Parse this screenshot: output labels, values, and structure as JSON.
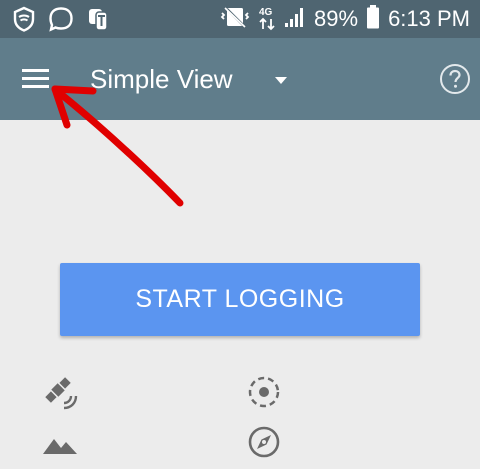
{
  "status_bar": {
    "battery_percent": "89%",
    "time": "6:13 PM",
    "left_icons": [
      "shield-icon",
      "chat-bubble-icon",
      "trophy-notification-icon"
    ],
    "right_icons": [
      "vibrate-mute-icon",
      "data-4g-icon",
      "signal-icon",
      "battery-icon"
    ]
  },
  "toolbar": {
    "title": "Simple View",
    "menu_icon": "hamburger-menu-icon",
    "dropdown_icon": "dropdown-arrow-icon",
    "help_icon": "help-icon"
  },
  "main": {
    "start_button_label": "START LOGGING",
    "icons": [
      "satellite-icon",
      "gps-fix-icon",
      "mountain-icon",
      "compass-icon"
    ]
  },
  "annotation": {
    "arrow_color": "#e00000"
  },
  "colors": {
    "status_bar": "#4f6571",
    "toolbar": "#607d8b",
    "background": "#ececec",
    "button": "#5b95f0",
    "icon_grey": "#6a6a6a"
  }
}
